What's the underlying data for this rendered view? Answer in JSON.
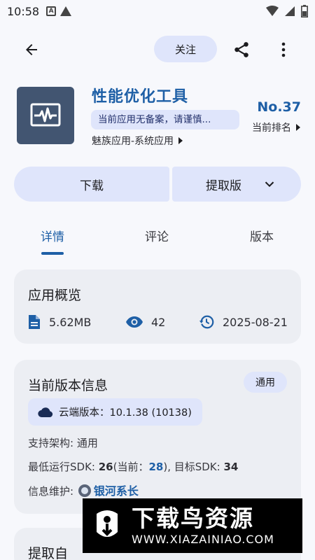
{
  "status_bar": {
    "time": "10:58",
    "left_icons": [
      "a-box-icon",
      "warning-icon"
    ],
    "right_icons": [
      "wifi-icon",
      "signal-icon",
      "battery-icon"
    ]
  },
  "toolbar": {
    "follow_label": "关注",
    "icons": [
      "back-arrow-icon",
      "share-icon",
      "more-vert-icon"
    ]
  },
  "app": {
    "name": "性能优化工具",
    "notice": "当前应用无备案，请谨慎...",
    "category": "魅族应用-系统应用",
    "rank_value": "No.37",
    "rank_label": "当前排名"
  },
  "actions": {
    "download_label": "下载",
    "extract_label": "提取版"
  },
  "tabs": [
    {
      "label": "详情",
      "active": true
    },
    {
      "label": "评论",
      "active": false
    },
    {
      "label": "版本",
      "active": false
    }
  ],
  "overview": {
    "title": "应用概览",
    "size": "5.62MB",
    "views": "42",
    "date": "2025-08-21"
  },
  "version_info": {
    "title": "当前版本信息",
    "badge": "通用",
    "cloud_label": "云端版本：",
    "cloud_version": "10.1.38 (10138)",
    "arch_label": "支持架构: ",
    "arch_value": "通用",
    "sdk_label": "最低运行SDK: ",
    "sdk_min": "26",
    "sdk_cur_open": "(当前：",
    "sdk_cur": "28",
    "sdk_cur_close": ")",
    "sdk_target_label": ", 目标SDK: ",
    "sdk_target": "34",
    "maintainer_label": "信息维护: ",
    "maintainer": "银河系长"
  },
  "extract_section": {
    "title": "提取自"
  },
  "watermark": {
    "title": "下载鸟资源",
    "url": "WWW.XIAZAINIAO.COM"
  },
  "colors": {
    "accent": "#1e5fa6",
    "chip": "#dfe5fb",
    "card": "#eceef3",
    "background": "#f7f8fc"
  }
}
